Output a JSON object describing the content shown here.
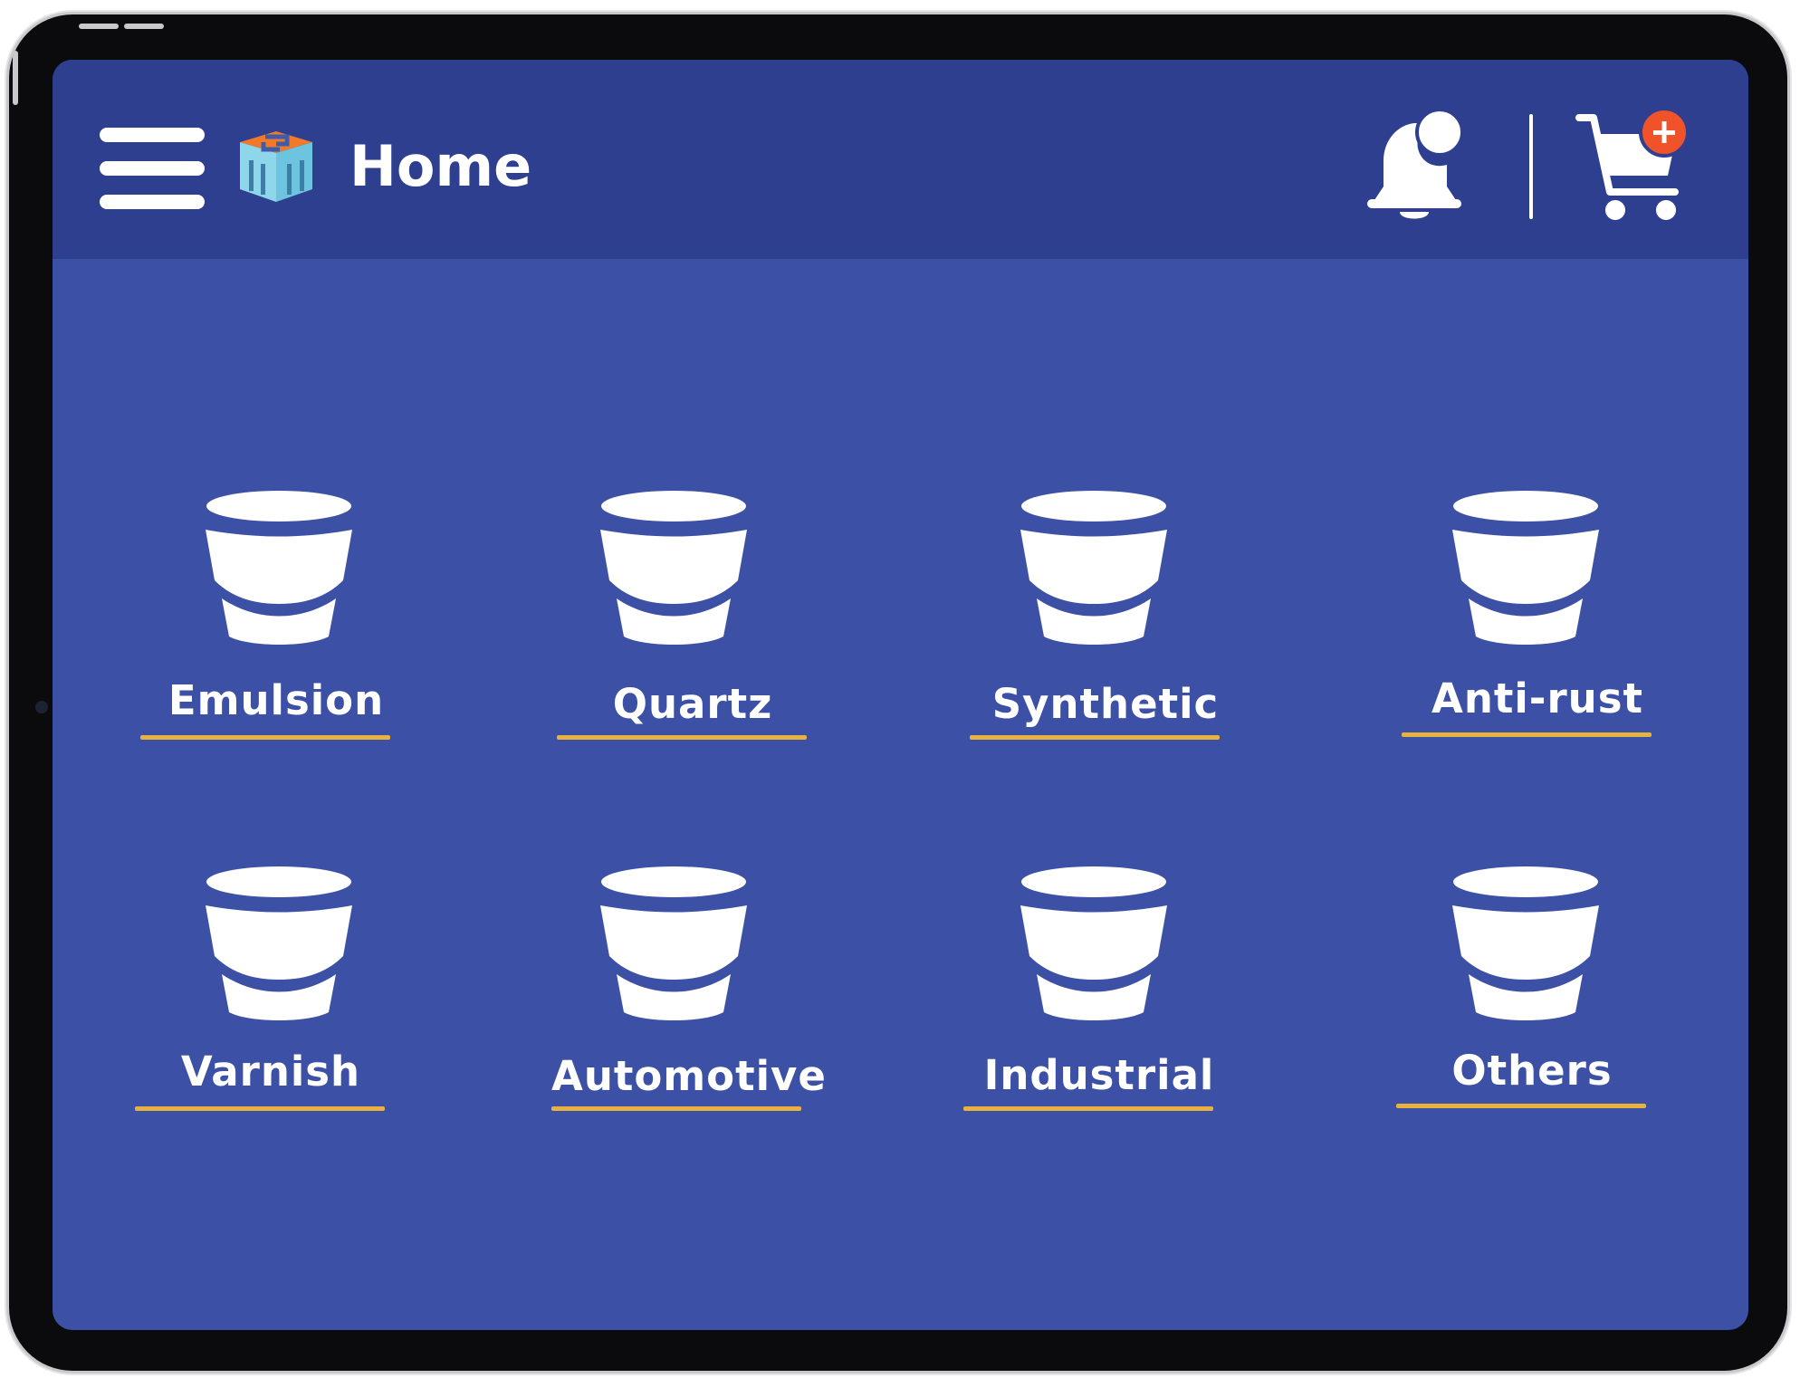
{
  "appbar": {
    "title": "Home",
    "menu_icon": "hamburger-menu-icon",
    "logo_icon": "store-logo-icon",
    "notification_icon": "bell-icon",
    "cart_icon": "cart-icon",
    "cart_badge_symbol": "+"
  },
  "categories": [
    {
      "label": "Emulsion",
      "icon": "paint-bucket-icon"
    },
    {
      "label": "Quartz",
      "icon": "paint-bucket-icon"
    },
    {
      "label": "Synthetic",
      "icon": "paint-bucket-icon"
    },
    {
      "label": "Anti-rust",
      "icon": "paint-bucket-icon"
    },
    {
      "label": "Varnish",
      "icon": "paint-bucket-icon"
    },
    {
      "label": "Automotive",
      "icon": "paint-bucket-icon"
    },
    {
      "label": "Industrial",
      "icon": "paint-bucket-icon"
    },
    {
      "label": "Others",
      "icon": "paint-bucket-icon"
    }
  ],
  "colors": {
    "screen_background": "#3c51a5",
    "appbar_background": "#2e3f90",
    "accent_underline": "#e9b23e",
    "badge": "#f0532a",
    "foreground": "#ffffff"
  }
}
